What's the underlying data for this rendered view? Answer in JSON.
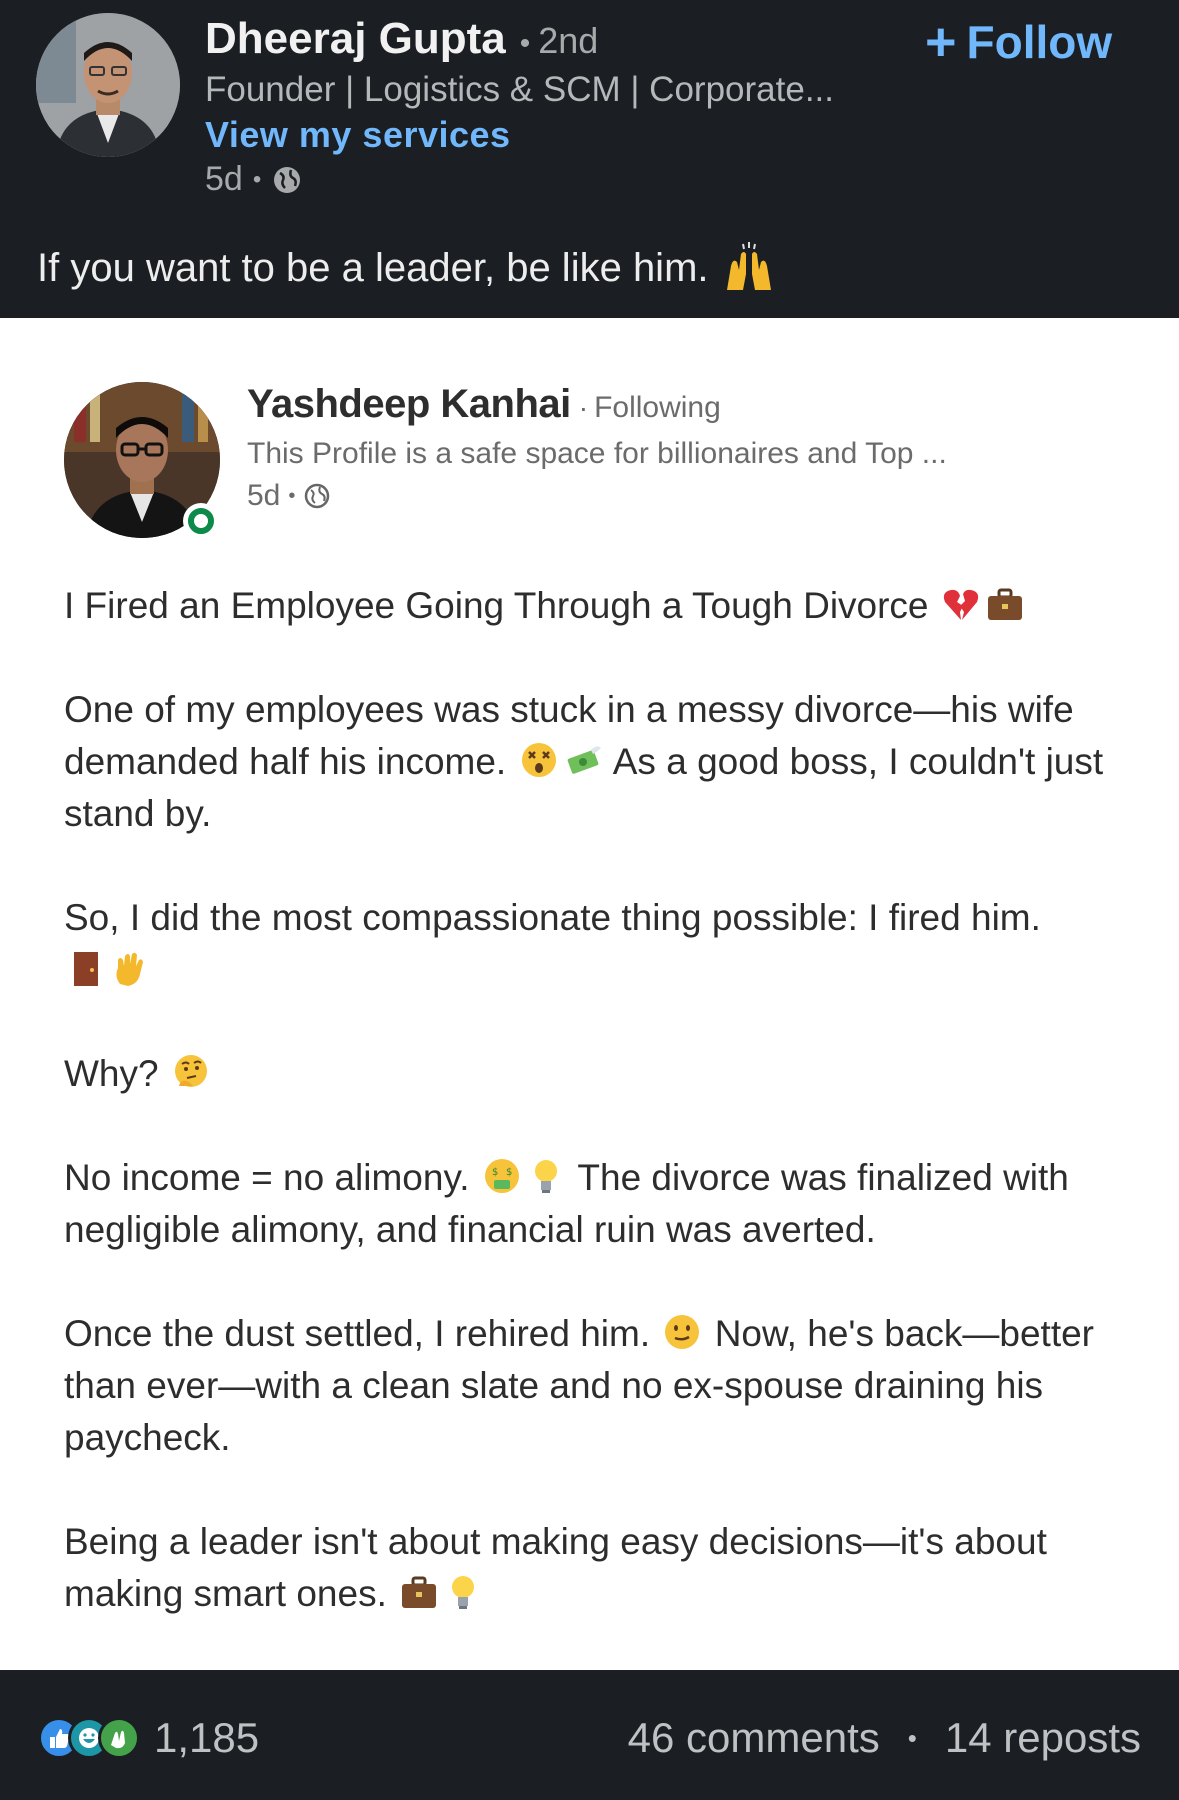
{
  "post": {
    "author_name": "Dheeraj Gupta",
    "connection_dot": "•",
    "connection_degree": "2nd",
    "headline": "Founder | Logistics & SCM | Corporate...",
    "services_link": "View my services",
    "age": "5d",
    "meta_sep": "•",
    "follow_label": "Follow",
    "follow_icon": "plus-icon",
    "caption": "If you want to be a leader, be like him.",
    "caption_emoji": "raising-hands-icon"
  },
  "embedded": {
    "author_name": "Yashdeep Kanhai",
    "name_dot": "·",
    "following_label": "Following",
    "headline": "This Profile is a safe space for billionaires and Top ...",
    "age": "5d",
    "meta_sep": "•",
    "body": {
      "p1": "I Fired an Employee Going Through a Tough Divorce",
      "p2a": "One of my employees was stuck in a messy divorce—his wife demanded half his income.",
      "p2b": "As a good boss, I couldn't just stand by.",
      "p3": "So, I did the most compassionate thing possible: I fired him.",
      "p4": "Why?",
      "p5a": "No income = no alimony.",
      "p5b": "The divorce was finalized with negligible alimony, and financial ruin was averted.",
      "p6a": "Once the dust settled, I rehired him.",
      "p6b": "Now, he's back—better than ever—with a clean slate and no ex-spouse draining his paycheck.",
      "p7": "Being a leader isn't about making easy decisions—it's about making smart ones."
    }
  },
  "footer": {
    "reactions_count": "1,185",
    "comments": "46 comments",
    "sep": "•",
    "reposts": "14 reposts"
  },
  "colors": {
    "background": "#1b1f23",
    "link_blue": "#71b7fb",
    "online_green": "#0b8a4a"
  }
}
